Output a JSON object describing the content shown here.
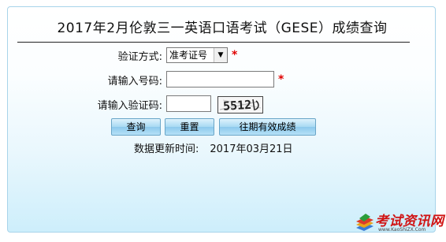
{
  "title": "2017年2月伦敦三一英语口语考试（GESE）成绩查询",
  "form": {
    "verify_method_label": "验证方式:",
    "verify_method_value": "准考证号",
    "number_label": "请输入号码:",
    "number_value": "",
    "captcha_label": "请输入验证码:",
    "captcha_value": "",
    "captcha_image_text": "5512",
    "required_mark": "*"
  },
  "buttons": {
    "query": "查询",
    "reset": "重置",
    "past_results": "往期有效成绩"
  },
  "update": {
    "label": "数据更新时间:",
    "date": "2017年03月21日"
  },
  "watermark": {
    "brand": "考试资讯网",
    "url": "www.KaoShiZX.Com"
  },
  "colors": {
    "required": "#e00000",
    "brand": "#d01515",
    "panel_border": "#a8d4ea",
    "button": "#a7d9f3"
  }
}
